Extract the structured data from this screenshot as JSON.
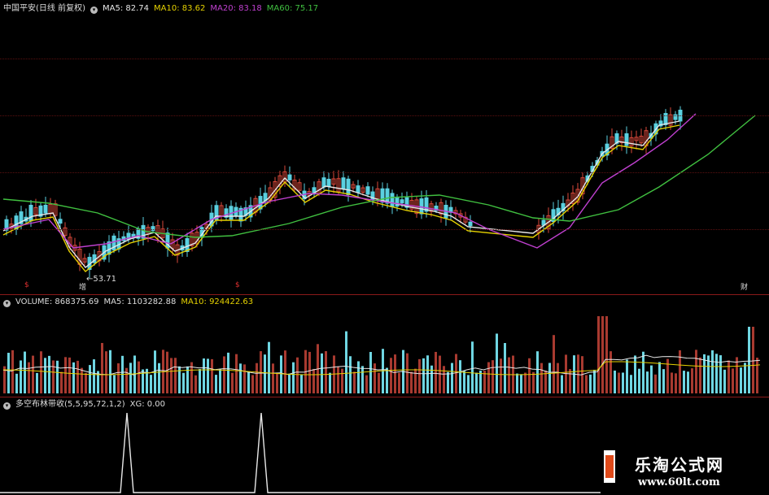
{
  "price_legend": {
    "title": "中国平安(日线 前复权)",
    "ma5": "MA5: 82.74",
    "ma10": "MA10: 83.62",
    "ma20": "MA20: 83.18",
    "ma60": "MA60: 75.17",
    "colors": {
      "ma5": "#e8e8e8",
      "ma10": "#e6d200",
      "ma20": "#c040d0",
      "ma60": "#40c040"
    }
  },
  "price_annotation": {
    "low_label": "←53.71"
  },
  "markers": {
    "m1": "$",
    "m2": "增",
    "m3": "$",
    "m4": "财"
  },
  "volume_legend": {
    "volume": "VOLUME: 868375.69",
    "ma5": "MA5: 1103282.88",
    "ma10": "MA10: 924422.63"
  },
  "indicator_legend": {
    "name": "多空布林带收(5,5,95,72,1,2)",
    "xg": "XG: 0.00"
  },
  "watermark": {
    "site_name": "乐淘公式网",
    "url": "www.60lt.com"
  },
  "icons": [
    "circle-menu-icon"
  ],
  "colors": {
    "up": "#d8483a",
    "down": "#5ad0e0",
    "grid": "#5a1010",
    "divider": "#8b1a1a"
  }
}
